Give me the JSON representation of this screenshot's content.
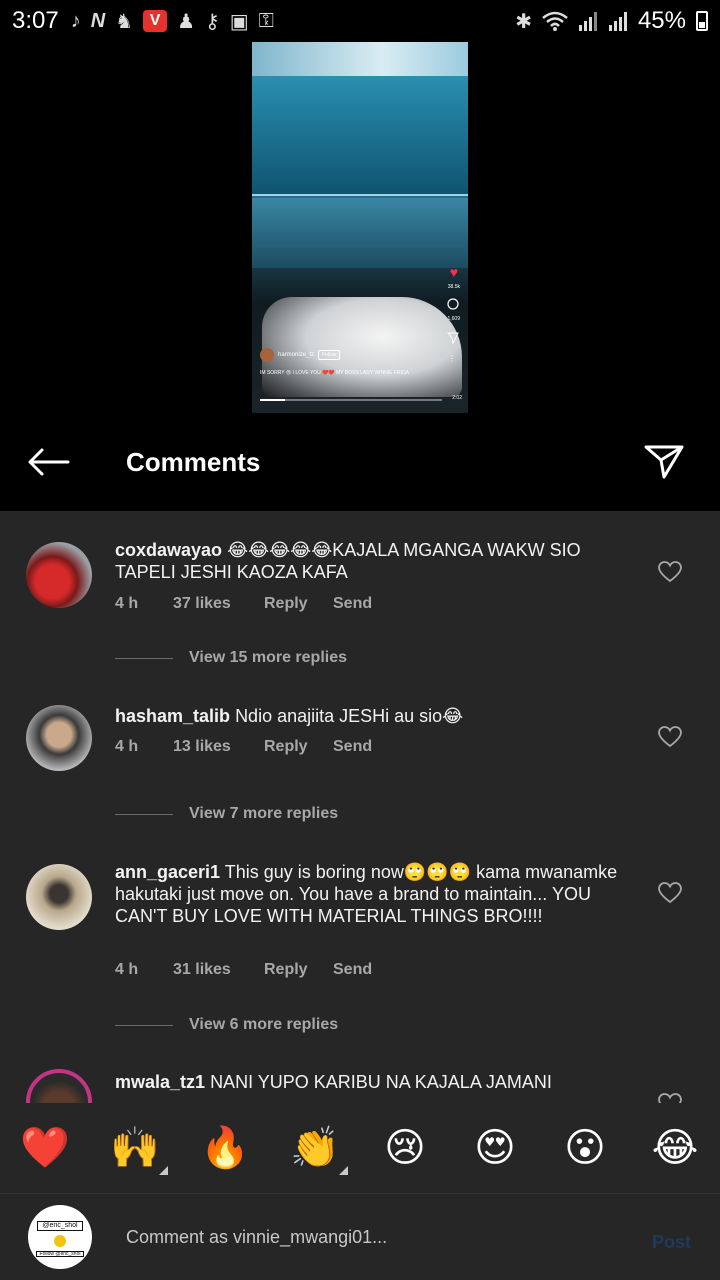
{
  "status_bar": {
    "time": "3:07",
    "battery": "45%",
    "left_icons": [
      "tiktok-icon",
      "n-icon",
      "premier-league-icon",
      "vivaldi-icon",
      "app-icon",
      "key-search-icon",
      "gallery-icon",
      "vpn-key-icon"
    ],
    "right_icons": [
      "bluetooth-icon",
      "wifi-icon",
      "signal-icon",
      "signal-icon",
      "battery-icon"
    ]
  },
  "video": {
    "username": "harmonize_tz",
    "follow_label": "Follow",
    "caption": "IM SORRY 😢 I LOVE YOU ❤️❤️ MY BOSS LADY WINNIE FRIDA",
    "likes": "38.5k",
    "comments": "1,609",
    "duration": "2:02",
    "progress": 0.14
  },
  "header": {
    "title": "Comments"
  },
  "comments": [
    {
      "username": "coxdawayao",
      "text": "😂😂😂😂😂KAJALA MGANGA WAKW SIO TAPELI JESHI KAOZA KAFA",
      "time": "4 h",
      "likes": "37 likes",
      "reply": "Reply",
      "send": "Send",
      "view_more": "View 15 more replies"
    },
    {
      "username": "hasham_talib",
      "text": "Ndio anajiita JESHi au sio😂",
      "time": "4 h",
      "likes": "13 likes",
      "reply": "Reply",
      "send": "Send",
      "view_more": "View 7 more replies"
    },
    {
      "username": "ann_gaceri1",
      "text": "This guy is boring now🙄🙄🙄 kama mwanamke hakutaki just move on. You have a brand to maintain... YOU CAN'T BUY LOVE WITH MATERIAL THINGS BRO!!!!",
      "time": "4 h",
      "likes": "31 likes",
      "reply": "Reply",
      "send": "Send",
      "view_more": "View 6 more replies"
    },
    {
      "username": "mwala_tz1",
      "text": "NANI YUPO KARIBU NA KAJALA JAMANI"
    }
  ],
  "emoji_bar": [
    "❤️",
    "🙌",
    "🔥",
    "👏",
    "😢",
    "😍",
    "😮",
    "😂"
  ],
  "input": {
    "placeholder": "Comment as vinnie_mwangi01...",
    "post_label": "Post",
    "avatar_text_1": "@eric_shol",
    "avatar_text_2": "Follow @eric_shol"
  },
  "colors": {
    "background": "#000000",
    "panel": "#262626",
    "secondary_text": "#a8a8a8",
    "like_red": "#ed4956",
    "post_disabled": "#1e3a5c"
  }
}
